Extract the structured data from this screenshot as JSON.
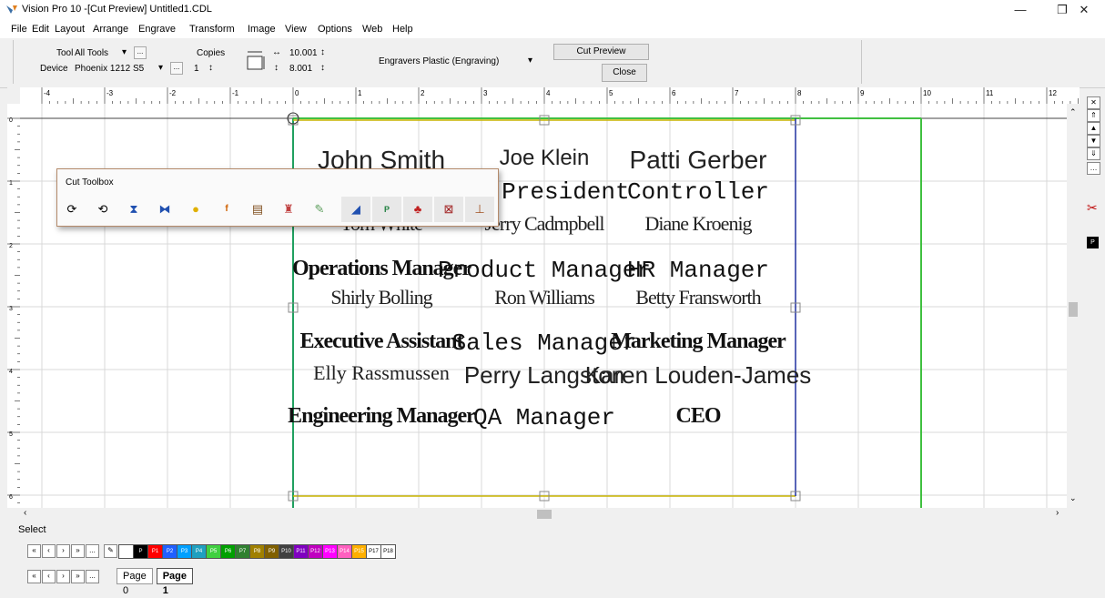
{
  "window": {
    "title": "Vision Pro 10 -[Cut Preview] Untitled1.CDL",
    "minimize": "—",
    "restore": "❐",
    "close": "✕"
  },
  "menu": [
    "File",
    "Edit",
    "Layout",
    "Arrange",
    "Engrave",
    "Transform",
    "Image",
    "View",
    "Options",
    "Web",
    "Help"
  ],
  "toolbar": {
    "tool_label": "Tool",
    "tool_value": "All Tools",
    "device_label": "Device",
    "device_value": "Phoenix 1212 S5",
    "copies_label": "Copies",
    "copies_value": "1",
    "width_value": "10.001",
    "height_value": "8.001",
    "material_value": "Engravers Plastic (Engraving)",
    "cut_preview_label": "Cut Preview",
    "close_label": "Close",
    "ellipsis": "...",
    "dropdown_arrow": "▾",
    "spin": "↕"
  },
  "ruler": {
    "top_labels": [
      "-4",
      "-3",
      "-2",
      "-1",
      "0",
      "1",
      "2",
      "3",
      "4",
      "5",
      "6",
      "7",
      "8",
      "9",
      "10",
      "11",
      "12"
    ],
    "left_labels": [
      "0",
      "1",
      "2",
      "3",
      "4",
      "5",
      "6"
    ]
  },
  "cut_toolbox": {
    "title": "Cut Toolbox",
    "tools": [
      "rotate-cw",
      "rotate-ccw",
      "fill",
      "flip",
      "bulb",
      "font",
      "raster",
      "layer",
      "clip",
      "engrave",
      "marker",
      "tree",
      "erase",
      "pin"
    ]
  },
  "cells": [
    {
      "name": "John Smith",
      "title": ""
    },
    {
      "name": "Joe Klein",
      "title": "ce-President"
    },
    {
      "name": "Patti Gerber",
      "title": "Controller"
    },
    {
      "name": "Tom White",
      "title": "Operations Manager"
    },
    {
      "name": "Jerry Cadmpbell",
      "title": "Product Manager"
    },
    {
      "name": "Diane Kroenig",
      "title": "HR Manager"
    },
    {
      "name": "Shirly Bolling",
      "title": "Executive Assistant"
    },
    {
      "name": "Ron Williams",
      "title": "Sales Manager"
    },
    {
      "name": "Betty Fransworth",
      "title": "Marketing Manager"
    },
    {
      "name": "Elly Rassmussen",
      "title": "Engineering Manager"
    },
    {
      "name": "Perry Langston",
      "title": "QA Manager"
    },
    {
      "name": "Karen Louden-James",
      "title": "CEO"
    }
  ],
  "status": {
    "text": "Select"
  },
  "colorbar": {
    "nav": [
      "«",
      "‹",
      "›",
      "»",
      "..."
    ],
    "swatches": [
      {
        "color": "#ffffff",
        "label": ""
      },
      {
        "color": "#000000",
        "label": "P"
      },
      {
        "color": "#ff0000",
        "label": "P1"
      },
      {
        "color": "#2060ff",
        "label": "P2"
      },
      {
        "color": "#00a0ff",
        "label": "P3"
      },
      {
        "color": "#1fa0c0",
        "label": "P4"
      },
      {
        "color": "#40d040",
        "label": "P5"
      },
      {
        "color": "#00a000",
        "label": "P6"
      },
      {
        "color": "#308030",
        "label": "P7"
      },
      {
        "color": "#a08000",
        "label": "P8"
      },
      {
        "color": "#806000",
        "label": "P9"
      },
      {
        "color": "#404040",
        "label": "P10"
      },
      {
        "color": "#8000c0",
        "label": "P11"
      },
      {
        "color": "#c000c0",
        "label": "P12"
      },
      {
        "color": "#ff00ff",
        "label": "P13"
      },
      {
        "color": "#ff60c0",
        "label": "P14"
      },
      {
        "color": "#ffb000",
        "label": "P15"
      },
      {
        "color": "#ffffff",
        "label": "P17"
      },
      {
        "color": "#ffffff",
        "label": "P18"
      }
    ]
  },
  "pages": {
    "nav": [
      "«",
      "‹",
      "›",
      "»",
      "..."
    ],
    "tabs": [
      "Page 0",
      "Page 1"
    ],
    "active": "Page 1"
  }
}
